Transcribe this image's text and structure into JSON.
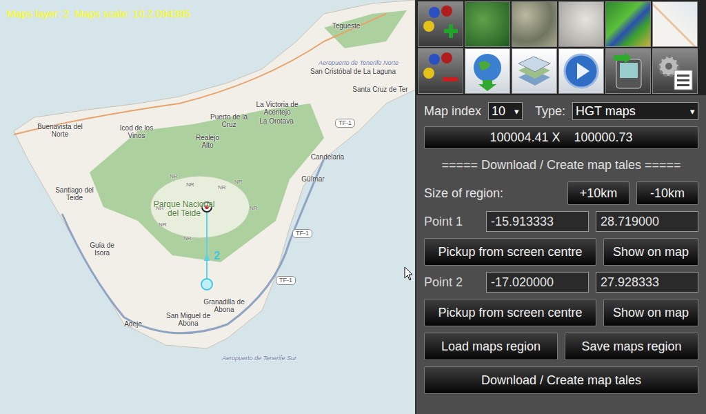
{
  "map": {
    "overlay": "Maps layer: 2  Maps scale: 10.2.094395",
    "route": {
      "label": "2"
    },
    "labels": [
      {
        "text": "Tegueste",
        "kind": "town"
      },
      {
        "text": "Aeropuerto de Tenerife Norte",
        "kind": "airport"
      },
      {
        "text": "San Cristóbal de La Laguna",
        "kind": "town"
      },
      {
        "text": "Santa Cruz de Ter",
        "kind": "town"
      },
      {
        "text": "La Victoria de Acentejo",
        "kind": "town"
      },
      {
        "text": "Puerto de la Cruz",
        "kind": "town"
      },
      {
        "text": "La Orotava",
        "kind": "town"
      },
      {
        "text": "Realejo Alto",
        "kind": "town"
      },
      {
        "text": "Icod de los Vinos",
        "kind": "town"
      },
      {
        "text": "Buenavista del Norte",
        "kind": "town"
      },
      {
        "text": "Candelaria",
        "kind": "town"
      },
      {
        "text": "Santiago del Teide",
        "kind": "town"
      },
      {
        "text": "Güímar",
        "kind": "town"
      },
      {
        "text": "Parque Nacional del Teide",
        "kind": "park"
      },
      {
        "text": "Guía de Isora",
        "kind": "town"
      },
      {
        "text": "Adeje",
        "kind": "town"
      },
      {
        "text": "Granadilla de Abona",
        "kind": "town"
      },
      {
        "text": "San Miguel de Abona",
        "kind": "town"
      },
      {
        "text": "Aeropuerto de Tenerife Sur",
        "kind": "airport"
      },
      {
        "text": "TF-1",
        "kind": "road"
      },
      {
        "text": "TF-1",
        "kind": "road"
      },
      {
        "text": "TF-1",
        "kind": "road"
      },
      {
        "text": "NR",
        "kind": "nr"
      },
      {
        "text": "NR",
        "kind": "nr"
      },
      {
        "text": "NR",
        "kind": "nr"
      },
      {
        "text": "NR",
        "kind": "nr"
      },
      {
        "text": "NR",
        "kind": "nr"
      },
      {
        "text": "NR",
        "kind": "nr"
      },
      {
        "text": "NR",
        "kind": "nr"
      },
      {
        "text": "NR",
        "kind": "nr"
      }
    ]
  },
  "panel": {
    "map_index": {
      "label": "Map index",
      "value": "10",
      "arrow": "▾"
    },
    "type": {
      "label": "Type:",
      "value": "HGT maps",
      "arrow": "▾"
    },
    "coordinates": "100004.41 X    100000.73",
    "section_title": "===== Download / Create map tales =====",
    "size": {
      "label": "Size of region:",
      "buttons": [
        "+10km",
        "-10km"
      ]
    },
    "points": [
      {
        "label": "Point 1",
        "longitude": "-15.913333",
        "latitude": "28.719000",
        "buttons": [
          "Pickup from screen centre",
          "Show on map"
        ]
      },
      {
        "label": "Point 2",
        "longitude": "-17.020000",
        "latitude": "27.928333",
        "buttons": [
          "Pickup from screen centre",
          "Show on map"
        ]
      }
    ],
    "region_buttons": [
      "Load maps region",
      "Save maps region"
    ],
    "download_button": "Download / Create map tales"
  }
}
